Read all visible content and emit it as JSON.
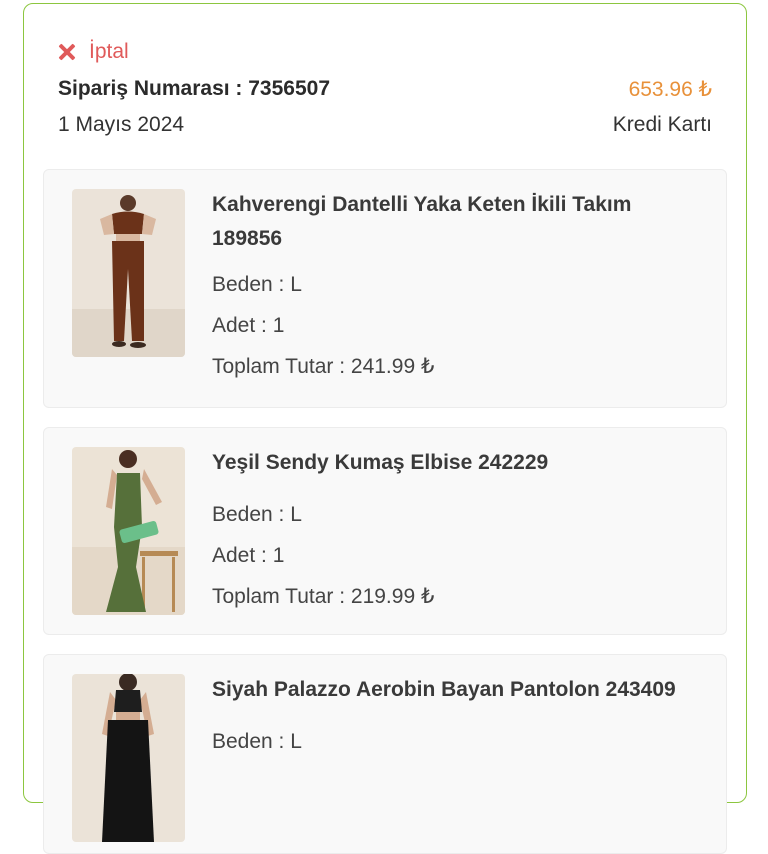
{
  "order": {
    "status": "İptal",
    "number_label": "Sipariş Numarası : 7356507",
    "total": "653.96 ₺",
    "date": "1 Mayıs 2024",
    "payment": "Kredi Kartı"
  },
  "products": [
    {
      "name": "Kahverengi Dantelli Yaka Keten İkili Takım 189856",
      "size": "Beden : L",
      "qty": "Adet : 1",
      "total": "Toplam Tutar : 241.99 ₺",
      "image": "brown-outfit-photo"
    },
    {
      "name": "Yeşil Sendy Kumaş Elbise 242229",
      "size": "Beden : L",
      "qty": "Adet : 1",
      "total": "Toplam Tutar : 219.99 ₺",
      "image": "green-dress-photo"
    },
    {
      "name": "Siyah Palazzo Aerobin Bayan Pantolon 243409",
      "size": "Beden : L",
      "qty": "",
      "total": "",
      "image": "black-outfit-photo"
    }
  ],
  "colors": {
    "card_border": "#8cc63f",
    "cancel": "#e05a5a",
    "price": "#e8913a"
  }
}
